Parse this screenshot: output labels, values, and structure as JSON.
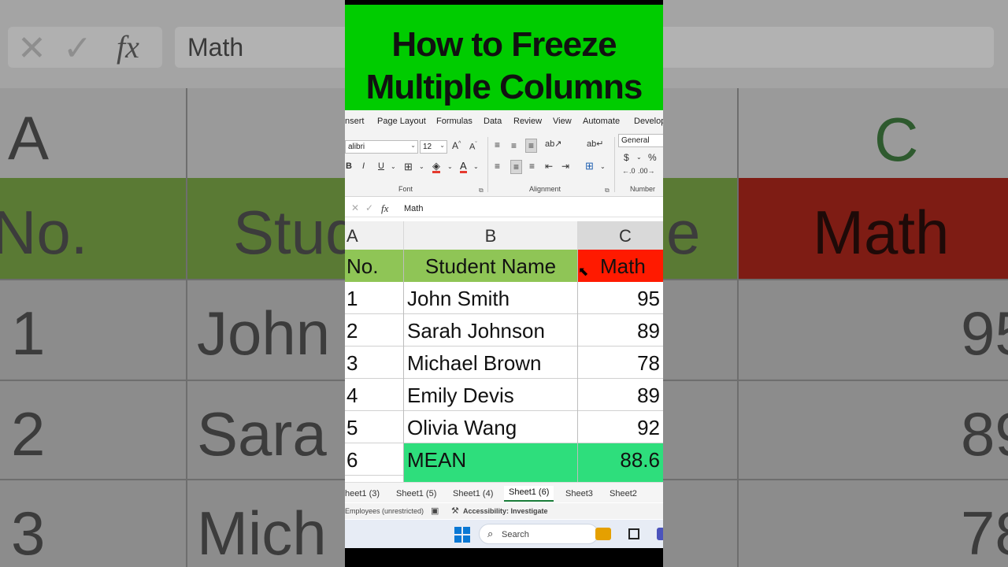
{
  "title": {
    "line1": "How to Freeze",
    "line2": "Multiple Columns"
  },
  "menu": [
    "nsert",
    "Page Layout",
    "Formulas",
    "Data",
    "Review",
    "View",
    "Automate",
    "Develop"
  ],
  "ribbon": {
    "font_name": "alibri",
    "font_size": "12",
    "number_format": "General",
    "groups": {
      "font": "Font",
      "alignment": "Alignment",
      "number": "Number"
    },
    "bold": "B",
    "italic": "I",
    "underline": "U",
    "currency": "$",
    "percent": "%"
  },
  "formula_bar": {
    "fx": "fx",
    "value": "Math"
  },
  "columns": [
    "A",
    "B",
    "C"
  ],
  "table": {
    "header": {
      "a": "No.",
      "b": "Student Name",
      "c": "Math"
    },
    "rows": [
      {
        "a": "1",
        "b": "John Smith",
        "c": "95"
      },
      {
        "a": "2",
        "b": "Sarah Johnson",
        "c": "89"
      },
      {
        "a": "3",
        "b": "Michael Brown",
        "c": "78"
      },
      {
        "a": "4",
        "b": "Emily Devis",
        "c": "89"
      },
      {
        "a": "5",
        "b": "Olivia Wang",
        "c": "92"
      }
    ],
    "mean": {
      "a": "6",
      "b": "MEAN",
      "c": "88.6"
    }
  },
  "sheet_tabs": [
    "heet1 (3)",
    "Sheet1 (5)",
    "Sheet1 (4)",
    "Sheet1 (6)",
    "Sheet3",
    "Sheet2"
  ],
  "active_tab": "Sheet1 (6)",
  "status": {
    "left": "Employees (unrestricted)",
    "accessibility": "Accessibility: Investigate"
  },
  "taskbar": {
    "search": "Search"
  },
  "background": {
    "formula_value": "Math",
    "col_a": "A",
    "col_c": "C",
    "hdr_no": "No.",
    "hdr_name": "Stud",
    "hdr_c_tail": "e",
    "hdr_math": "Math",
    "rows": [
      {
        "num": "1",
        "name": "John",
        "val": "95"
      },
      {
        "num": "2",
        "name": "Sara",
        "val": "89"
      },
      {
        "num": "3",
        "name": "Mich",
        "val": "78"
      }
    ]
  },
  "colors": {
    "title_bg": "#00cc00",
    "header_green": "#8fc556",
    "header_red": "#ff1a00",
    "mean_green": "#2ede7c"
  }
}
